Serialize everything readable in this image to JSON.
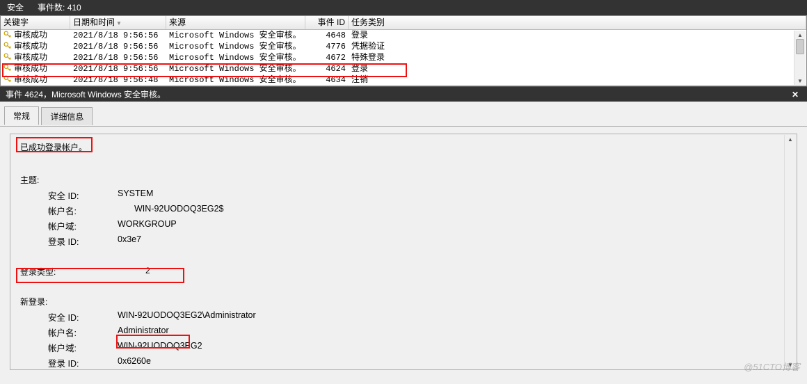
{
  "title_bar": {
    "label": "安全",
    "event_count_label": "事件数:",
    "event_count_value": "410"
  },
  "columns": {
    "keyword": "关键字",
    "datetime": "日期和时间",
    "source": "来源",
    "event_id": "事件 ID",
    "task_category": "任务类别"
  },
  "rows": [
    {
      "keyword": "审核成功",
      "datetime": "2021/8/18 9:56:56",
      "source": "Microsoft Windows 安全审核。",
      "event_id": "4648",
      "category": "登录"
    },
    {
      "keyword": "审核成功",
      "datetime": "2021/8/18 9:56:56",
      "source": "Microsoft Windows 安全审核。",
      "event_id": "4776",
      "category": "凭据验证"
    },
    {
      "keyword": "审核成功",
      "datetime": "2021/8/18 9:56:56",
      "source": "Microsoft Windows 安全审核。",
      "event_id": "4672",
      "category": "特殊登录"
    },
    {
      "keyword": "审核成功",
      "datetime": "2021/8/18 9:56:56",
      "source": "Microsoft Windows 安全审核。",
      "event_id": "4624",
      "category": "登录"
    },
    {
      "keyword": "审核成功",
      "datetime": "2021/8/18 9:56:48",
      "source": "Microsoft Windows 安全审核。",
      "event_id": "4634",
      "category": "注销"
    }
  ],
  "detail_header": "事件 4624，Microsoft Windows 安全审核。",
  "tabs": {
    "general": "常规",
    "details": "详细信息"
  },
  "detail": {
    "login_success": "已成功登录帐户。",
    "subject_title": "主题:",
    "subject": {
      "security_id_label": "安全 ID:",
      "security_id_value": "SYSTEM",
      "account_name_label": "帐户名:",
      "account_name_value": "WIN-92UODOQ3EG2$",
      "account_domain_label": "帐户域:",
      "account_domain_value": "WORKGROUP",
      "logon_id_label": "登录 ID:",
      "logon_id_value": "0x3e7"
    },
    "logon_type_label": "登录类型:",
    "logon_type_value": "2",
    "new_logon_title": "新登录:",
    "new_logon": {
      "security_id_label": "安全 ID:",
      "security_id_value": "WIN-92UODOQ3EG2\\Administrator",
      "account_name_label": "帐户名:",
      "account_name_value": "Administrator",
      "account_domain_label": "帐户域:",
      "account_domain_value": "WIN-92UODOQ3EG2",
      "logon_id_label": "登录 ID:",
      "logon_id_value": "0x6260e"
    }
  },
  "watermark": "@51CTO博客"
}
